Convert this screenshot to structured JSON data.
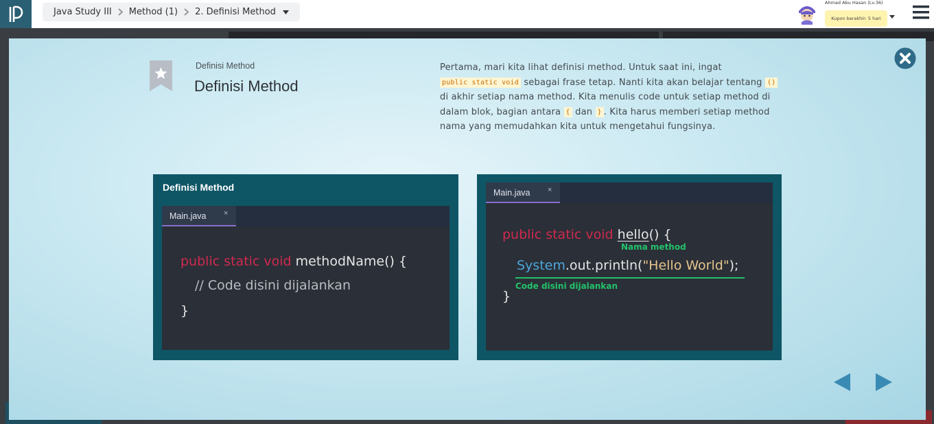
{
  "header": {
    "breadcrumb": [
      "Java Study III",
      "Method (1)",
      "2. Definisi Method"
    ],
    "user_name": "Ahmad Abu Hasan (Lv.36)",
    "coupon": "Kupon berakhir: 5 hari"
  },
  "slide": {
    "subtitle": "Definisi Method",
    "title": "Definisi Method",
    "desc": {
      "t1": "Pertama, mari kita lihat definisi method. Untuk saat ini, ingat ",
      "c1": "public static void",
      "t2": " sebagai frase tetap. Nanti kita akan belajar tentang ",
      "c2": "()",
      "t3": " di akhir setiap nama method. Kita menulis code untuk setiap method di dalam blok, bagian antara ",
      "c3": "{",
      "t4": " dan ",
      "c4": "}",
      "t5": ". Kita harus memberi setiap method nama yang memudahkan kita untuk mengetahui fungsinya."
    }
  },
  "panel_left": {
    "heading": "Definisi Method",
    "tab_label": "Main.java",
    "tab_close": "×",
    "line1_kw": "public static void",
    "line1_rest": " methodName() {",
    "line2": "// Code disini dijalankan",
    "line3": "}"
  },
  "panel_right": {
    "tab_label": "Main.java",
    "tab_close": "×",
    "line1_kw": "public static void",
    "line1_name": "hello",
    "line1_rest": "() {",
    "ann1": "Nama method",
    "line2_cls": "System",
    "line2_mid": ".out.println(",
    "line2_str": "\"Hello World\"",
    "line2_end": ");",
    "ann2": "Code disini dijalankan",
    "line3": "}"
  },
  "colors": {
    "keyword": "#d0294f",
    "annotation": "#22c26a",
    "panel": "#0e5666",
    "editor": "#2b2f37"
  },
  "icons": [
    "logo-icon",
    "chevron-right-icon",
    "caret-down-icon",
    "avatar",
    "hamburger-menu-icon",
    "close-icon",
    "bookmark-star-icon",
    "arrow-left-icon",
    "arrow-right-icon"
  ]
}
